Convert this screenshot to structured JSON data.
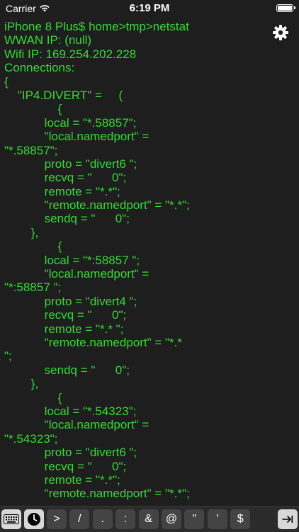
{
  "status": {
    "carrier": "Carrier",
    "time": "6:19 PM"
  },
  "terminal": {
    "lines": [
      "iPhone 8 Plus$ home>tmp>netstat",
      "WWAN IP: (null)",
      "Wifi IP: 169.254.202.228",
      "Connections:",
      "{",
      "    \"IP4.DIVERT\" =     (",
      "                {",
      "            local = \"*.58857\";",
      "            \"local.namedport\" =",
      "\"*.58857\";",
      "            proto = \"divert6 \";",
      "            recvq = \"      0\";",
      "            remote = \"*.*\";",
      "            \"remote.namedport\" = \"*.*\";",
      "            sendq = \"      0\";",
      "        },",
      "                {",
      "            local = \"*:58857 \";",
      "            \"local.namedport\" =",
      "\"*:58857 \";",
      "            proto = \"divert4 \";",
      "            recvq = \"      0\";",
      "            remote = \"*.* \";",
      "            \"remote.namedport\" = \"*.*",
      "\";",
      "            sendq = \"      0\";",
      "        },",
      "                {",
      "            local = \"*.54323\";",
      "            \"local.namedport\" =",
      "\"*.54323\";",
      "            proto = \"divert6 \";",
      "            recvq = \"      0\";",
      "            remote = \"*.*\";",
      "            \"remote.namedport\" = \"*.*\";"
    ]
  },
  "toolbar": {
    "keys": [
      ">",
      "/",
      ".",
      ":",
      "&",
      "@",
      "\"",
      "'",
      "$"
    ]
  },
  "icons": {
    "settings": "gear-icon",
    "keyboard": "keyboard-icon",
    "history": "clock-icon",
    "tab": "tab-arrow-icon"
  }
}
